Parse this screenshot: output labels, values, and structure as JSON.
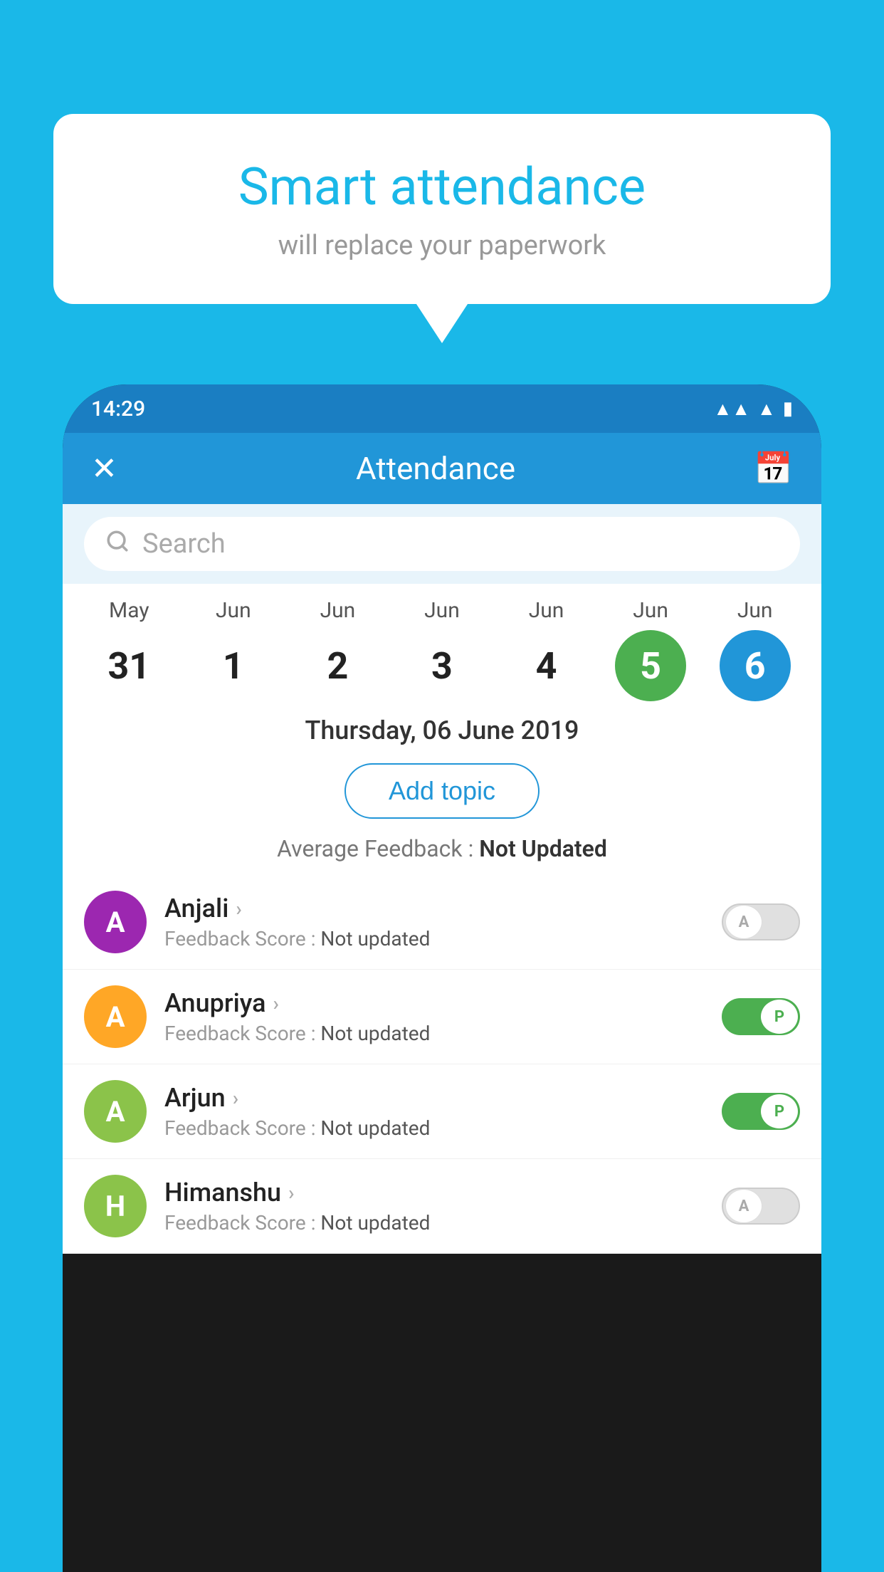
{
  "background_color": "#1ab8e8",
  "speech_bubble": {
    "title": "Smart attendance",
    "subtitle": "will replace your paperwork"
  },
  "status_bar": {
    "time": "14:29",
    "wifi_icon": "wifi",
    "signal_icon": "signal",
    "battery_icon": "battery"
  },
  "app_header": {
    "title": "Attendance",
    "close_label": "✕",
    "calendar_label": "📅"
  },
  "search": {
    "placeholder": "Search"
  },
  "calendar": {
    "columns": [
      {
        "month": "May",
        "day": "31",
        "state": "normal"
      },
      {
        "month": "Jun",
        "day": "1",
        "state": "normal"
      },
      {
        "month": "Jun",
        "day": "2",
        "state": "normal"
      },
      {
        "month": "Jun",
        "day": "3",
        "state": "normal"
      },
      {
        "month": "Jun",
        "day": "4",
        "state": "normal"
      },
      {
        "month": "Jun",
        "day": "5",
        "state": "today"
      },
      {
        "month": "Jun",
        "day": "6",
        "state": "selected"
      }
    ]
  },
  "selected_date": "Thursday, 06 June 2019",
  "add_topic_button": "Add topic",
  "average_feedback_label": "Average Feedback : ",
  "average_feedback_value": "Not Updated",
  "students": [
    {
      "name": "Anjali",
      "initial": "A",
      "avatar_color": "#9c27b0",
      "feedback_label": "Feedback Score : ",
      "feedback_value": "Not updated",
      "toggle_state": "off",
      "toggle_label": "A"
    },
    {
      "name": "Anupriya",
      "initial": "A",
      "avatar_color": "#ffa726",
      "feedback_label": "Feedback Score : ",
      "feedback_value": "Not updated",
      "toggle_state": "on",
      "toggle_label": "P"
    },
    {
      "name": "Arjun",
      "initial": "A",
      "avatar_color": "#8bc34a",
      "feedback_label": "Feedback Score : ",
      "feedback_value": "Not updated",
      "toggle_state": "on",
      "toggle_label": "P"
    },
    {
      "name": "Himanshu",
      "initial": "H",
      "avatar_color": "#8bc34a",
      "feedback_label": "Feedback Score : ",
      "feedback_value": "Not updated",
      "toggle_state": "off",
      "toggle_label": "A"
    }
  ]
}
